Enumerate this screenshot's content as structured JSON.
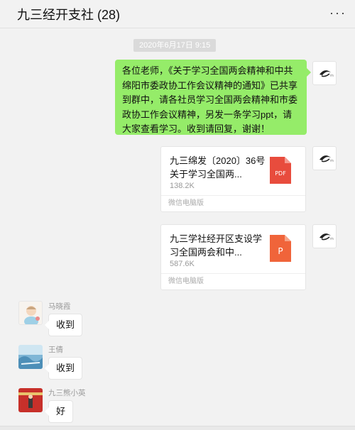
{
  "header": {
    "title": "九三经开支社 (28)",
    "more_label": "···"
  },
  "timestamp": "2020年6月17日 9:15",
  "messages": {
    "announcement": "各位老师，《关于学习全国两会精神和中共绵阳市委政协工作会议精神的通知》已共享到群中，请各社员学习全国两会精神和市委政协工作会议精神，另发一条学习ppt，请大家查看学习。收到请回复，谢谢！",
    "files": [
      {
        "name": "九三绵发〔2020〕36号  关于学习全国两...",
        "size": "138.2K",
        "source": "微信电脑版",
        "icon_label": "PDF",
        "icon_color": "#e84c3d"
      },
      {
        "name": "九三学社经开区支设学习全国两会和中...",
        "size": "587.6K",
        "source": "微信电脑版",
        "icon_label": "P",
        "icon_color": "#f0643a"
      }
    ],
    "replies": [
      {
        "sender": "马晓霞",
        "text": "收到"
      },
      {
        "sender": "王倩",
        "text": "收到"
      },
      {
        "sender": "九三熊小英",
        "text": "好"
      }
    ]
  },
  "colors": {
    "self_bubble": "#95ec69",
    "other_bubble": "#ffffff",
    "background": "#f2f2f2"
  }
}
